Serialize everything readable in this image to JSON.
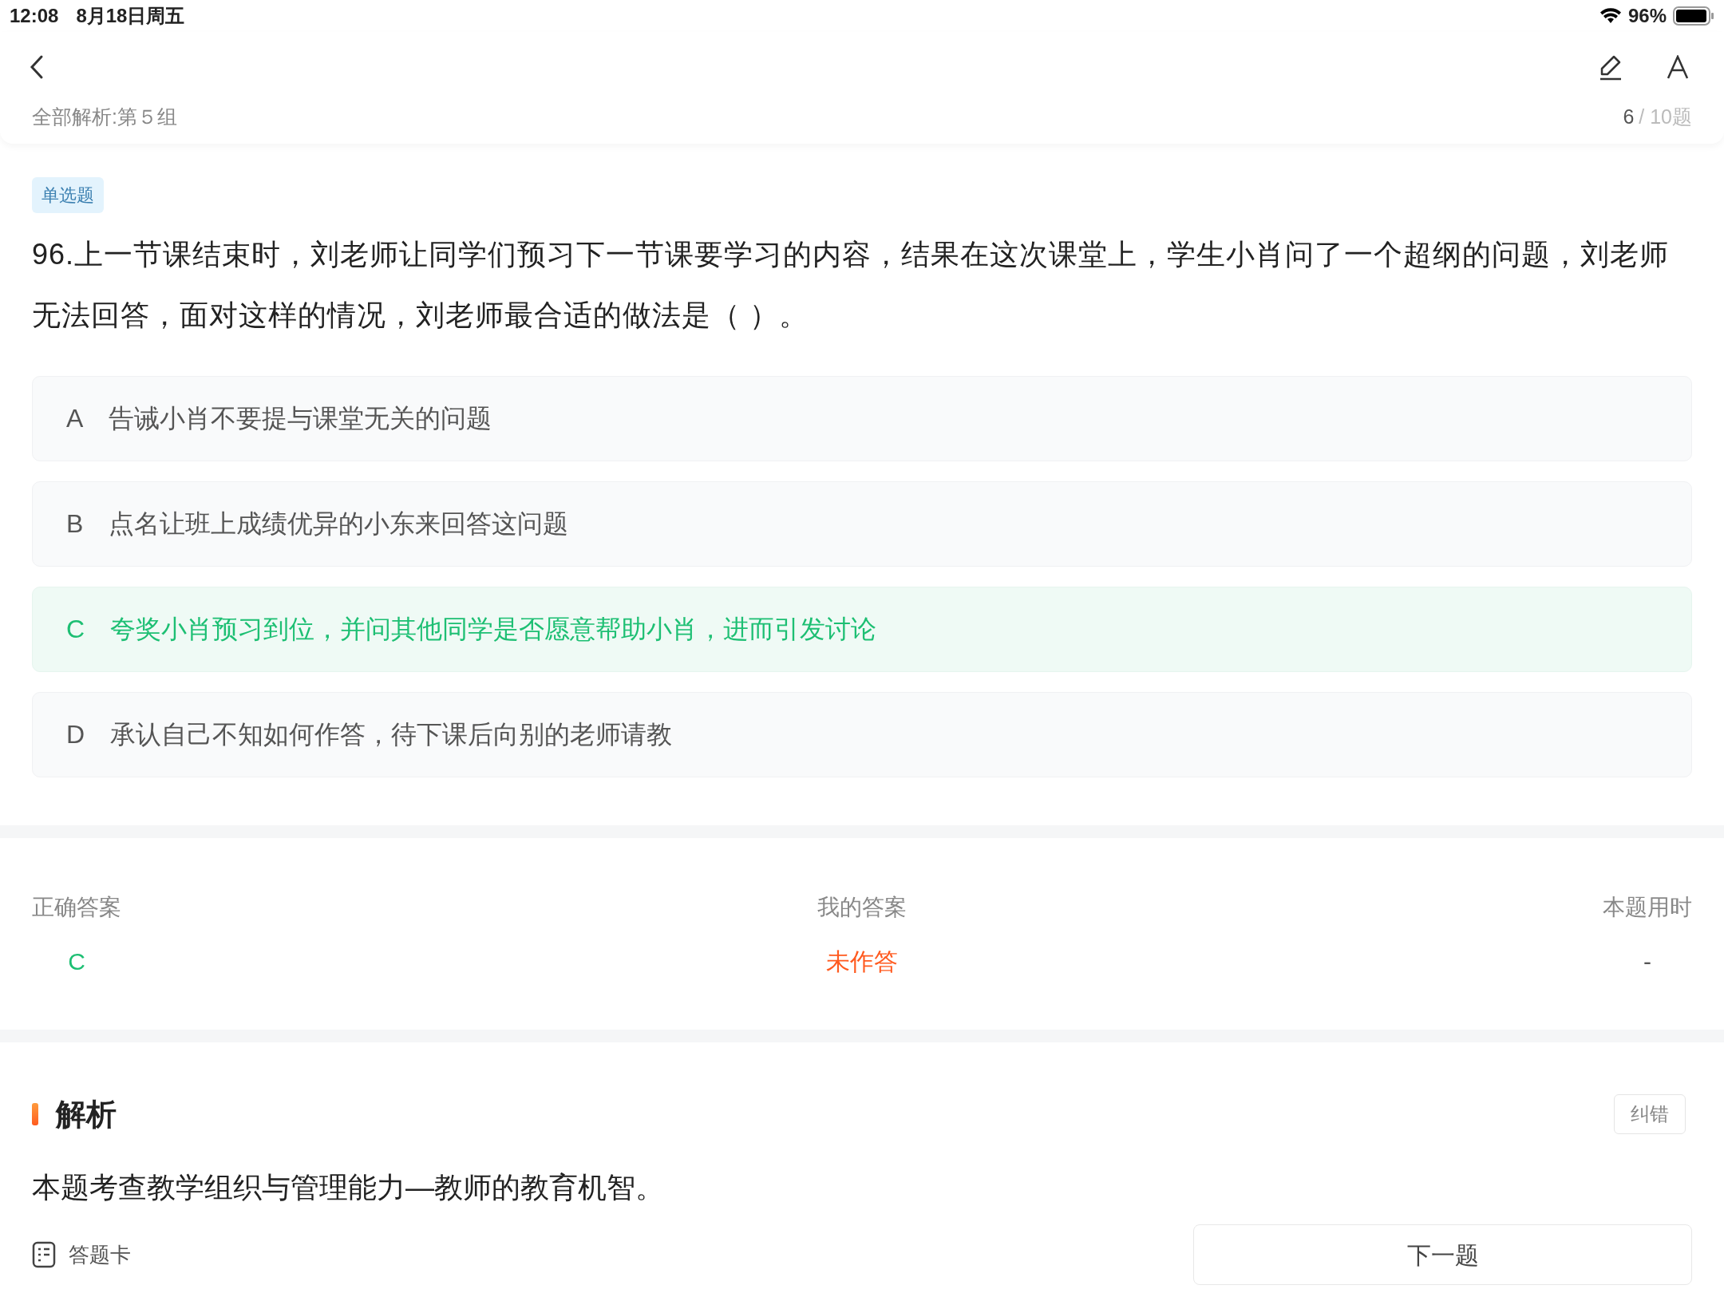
{
  "status_bar": {
    "time": "12:08",
    "date": "8月18日周五",
    "battery": "96%"
  },
  "header": {
    "breadcrumb": "全部解析:第５组",
    "progress_current": "6",
    "progress_total": "/ 10题"
  },
  "question": {
    "type_tag": "单选题",
    "text": "96.上一节课结束时，刘老师让同学们预习下一节课要学习的内容，结果在这次课堂上，学生小肖问了一个超纲的问题，刘老师无法回答，面对这样的情况，刘老师最合适的做法是（ ）。",
    "options": [
      {
        "letter": "A",
        "text": "告诫小肖不要提与课堂无关的问题",
        "correct": false
      },
      {
        "letter": "B",
        "text": "点名让班上成绩优异的小东来回答这问题",
        "correct": false
      },
      {
        "letter": "C",
        "text": "夸奖小肖预习到位，并问其他同学是否愿意帮助小肖，进而引发讨论",
        "correct": true
      },
      {
        "letter": "D",
        "text": "承认自己不知如何作答，待下课后向别的老师请教",
        "correct": false
      }
    ]
  },
  "answers": [
    {
      "label": "正确答案",
      "value": "C",
      "kind": "correct"
    },
    {
      "label": "我的答案",
      "value": "未作答",
      "kind": "unanswered"
    },
    {
      "label": "本题用时",
      "value": "-",
      "kind": "plain"
    }
  ],
  "analysis": {
    "title": "解析",
    "report_button": "纠错",
    "text": "本题考查教学组织与管理能力—教师的教育机智。"
  },
  "bottom_bar": {
    "answer_card": "答题卡",
    "next_button": "下一题"
  }
}
